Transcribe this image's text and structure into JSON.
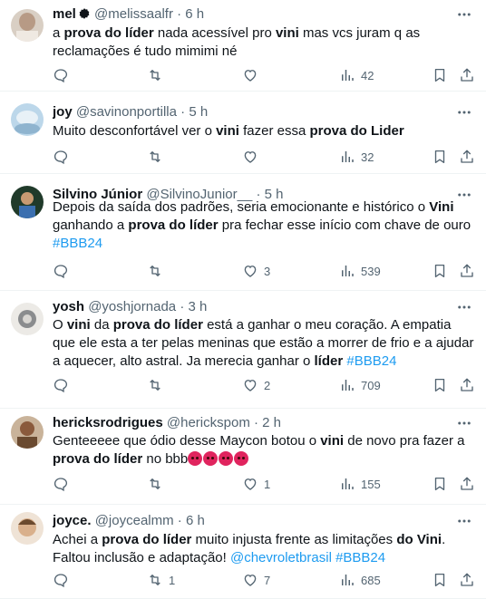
{
  "tweets": [
    {
      "name": "mel",
      "handle": "@melissaalfr",
      "dot": "·",
      "time": "6 h",
      "segments": [
        {
          "t": "a "
        },
        {
          "t": "prova do líder",
          "b": true
        },
        {
          "t": " nada acessível pro "
        },
        {
          "t": "vini",
          "b": true
        },
        {
          "t": " mas vcs juram q as reclamações é tudo mimimi né"
        }
      ],
      "reply": "",
      "retweet": "",
      "like": "",
      "views": "42"
    },
    {
      "name": "joy",
      "handle": "@savinonportilla",
      "dot": "·",
      "time": "5 h",
      "segments": [
        {
          "t": "Muito desconfortável ver o "
        },
        {
          "t": "vini",
          "b": true
        },
        {
          "t": " fazer essa "
        },
        {
          "t": "prova do Lider",
          "b": true
        }
      ],
      "reply": "",
      "retweet": "",
      "like": "",
      "views": "32"
    },
    {
      "name": "Silvino Júnior",
      "handle": "@SilvinoJunior__",
      "dot": "·",
      "time": "5 h",
      "segments": [
        {
          "t": "Depois da saída dos padrões, seria emocionante e histórico o "
        },
        {
          "t": "Vini",
          "b": true
        },
        {
          "t": " ganhando a "
        },
        {
          "t": "prova do líder",
          "b": true
        },
        {
          "t": " pra fechar esse início com chave de ouro "
        },
        {
          "t": "#BBB24",
          "tag": true
        }
      ],
      "reply": "",
      "retweet": "",
      "like": "3",
      "views": "539"
    },
    {
      "name": "yosh",
      "handle": "@yoshjornada",
      "dot": "·",
      "time": "3 h",
      "segments": [
        {
          "t": "O "
        },
        {
          "t": "vini",
          "b": true
        },
        {
          "t": " da "
        },
        {
          "t": "prova do líder",
          "b": true
        },
        {
          "t": " está a ganhar o meu coração. A empatia que ele esta a ter pelas meninas que estão a morrer de frio e a ajudar a aquecer, alto astral. Ja merecia ganhar o "
        },
        {
          "t": "líder",
          "b": true
        },
        {
          "t": " "
        },
        {
          "t": "#BBB24",
          "tag": true
        }
      ],
      "reply": "",
      "retweet": "",
      "like": "2",
      "views": "709"
    },
    {
      "name": "hericksrodrigues",
      "handle": "@herickspom",
      "dot": "·",
      "time": "2 h",
      "segments": [
        {
          "t": "Genteeeee que ódio desse Maycon botou o "
        },
        {
          "t": "vini",
          "b": true
        },
        {
          "t": " de novo pra fazer a "
        },
        {
          "t": "prova do líder",
          "b": true
        },
        {
          "t": " no bbb"
        },
        {
          "emoji": 4
        }
      ],
      "reply": "",
      "retweet": "",
      "like": "1",
      "views": "155"
    },
    {
      "name": "joyce.",
      "handle": "@joycealmm",
      "dot": "·",
      "time": "6 h",
      "segments": [
        {
          "t": "Achei a "
        },
        {
          "t": "prova do líder",
          "b": true
        },
        {
          "t": " muito injusta frente as limitações "
        },
        {
          "t": "do Vini",
          "b": true
        },
        {
          "t": ". Faltou inclusão e adaptação! "
        },
        {
          "t": "@chevroletbrasil",
          "tag": true
        },
        {
          "t": " "
        },
        {
          "t": "#BBB24",
          "tag": true
        }
      ],
      "reply": "",
      "retweet": "1",
      "like": "7",
      "views": "685"
    }
  ],
  "colors": {
    "text": "#0f1419",
    "muted": "#536471",
    "link": "#1d9bf0",
    "divider": "#eff3f4"
  }
}
